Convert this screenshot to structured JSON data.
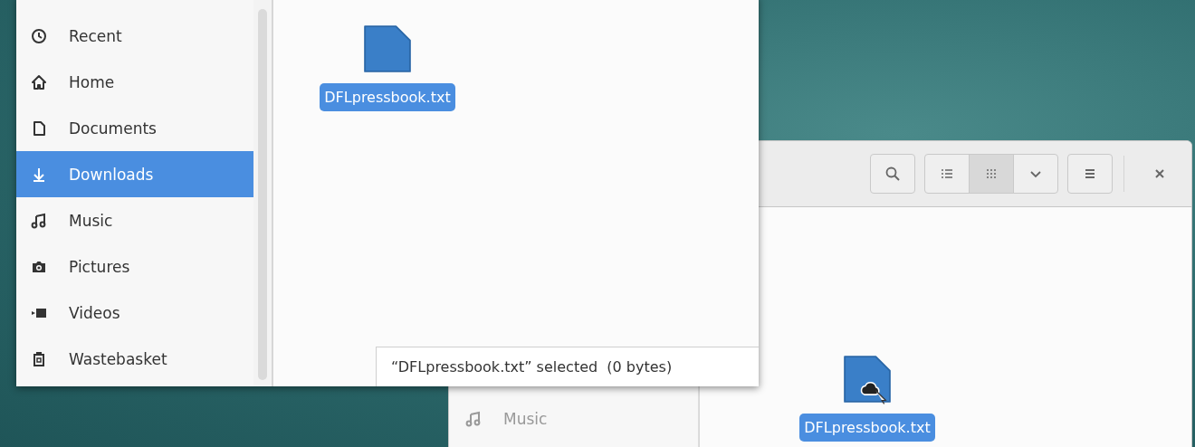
{
  "back_window": {
    "toolbar": {
      "view_buttons": [
        {
          "kind": "list",
          "selected": false
        },
        {
          "kind": "grid",
          "selected": true
        },
        {
          "kind": "dropdown",
          "selected": false
        }
      ]
    },
    "sidebar": {
      "items": [
        {
          "label": "Music",
          "kind": "music",
          "selected": false
        }
      ]
    },
    "files": [
      {
        "name": "DFLpressbook.txt",
        "selected": true
      }
    ]
  },
  "front_window": {
    "sidebar": {
      "items": [
        {
          "label": "Recent",
          "kind": "recent",
          "selected": false
        },
        {
          "label": "Home",
          "kind": "home",
          "selected": false
        },
        {
          "label": "Documents",
          "kind": "documents",
          "selected": false
        },
        {
          "label": "Downloads",
          "kind": "downloads",
          "selected": true
        },
        {
          "label": "Music",
          "kind": "music",
          "selected": false
        },
        {
          "label": "Pictures",
          "kind": "pictures",
          "selected": false
        },
        {
          "label": "Videos",
          "kind": "videos",
          "selected": false
        },
        {
          "label": "Wastebasket",
          "kind": "trash",
          "selected": false
        }
      ]
    },
    "files": [
      {
        "name": "DFLpressbook.txt",
        "selected": true
      }
    ],
    "status": "“DFLpressbook.txt” selected  (0 bytes)"
  }
}
